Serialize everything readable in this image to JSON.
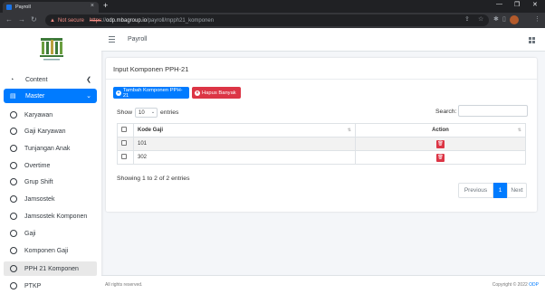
{
  "browser": {
    "tab_title": "Payroll",
    "new_tab": "+",
    "security_label": "Not secure",
    "url_scheme": "https",
    "url_sep": "://",
    "url_host": "odp.mbagroup.io",
    "url_path": "/payroll/mpph21_komponen"
  },
  "sidebar": {
    "content_label": "Content",
    "master_label": "Master",
    "items": [
      {
        "label": "Karyawan"
      },
      {
        "label": "Gaji Karyawan"
      },
      {
        "label": "Tunjangan Anak"
      },
      {
        "label": "Overtime"
      },
      {
        "label": "Grup Shift"
      },
      {
        "label": "Jamsostek"
      },
      {
        "label": "Jamsostek Komponen"
      },
      {
        "label": "Gaji"
      },
      {
        "label": "Komponen Gaji"
      },
      {
        "label": "PPH 21 Komponen"
      },
      {
        "label": "PTKP"
      }
    ]
  },
  "header": {
    "title": "Payroll"
  },
  "card": {
    "title": "Input Komponen PPH-21",
    "add_button": "Tambah Komponen PPH-21",
    "delete_button": "Hapus Banyak",
    "show_label": "Show",
    "entries_value": "10",
    "entries_label": "entries",
    "search_label": "Search:",
    "table": {
      "headers": [
        "Kode Gaji",
        "Action"
      ],
      "rows": [
        {
          "kode": "101"
        },
        {
          "kode": "302"
        }
      ]
    },
    "info": "Showing 1 to 2 of 2 entries",
    "pagination": {
      "prev": "Previous",
      "current": "1",
      "next": "Next"
    }
  },
  "footer": {
    "left": "All rights reserved.",
    "right_prefix": "Copyright © 2022 ",
    "right_brand": "ODP"
  },
  "colors": {
    "primary": "#007bff",
    "danger": "#dc3545"
  }
}
